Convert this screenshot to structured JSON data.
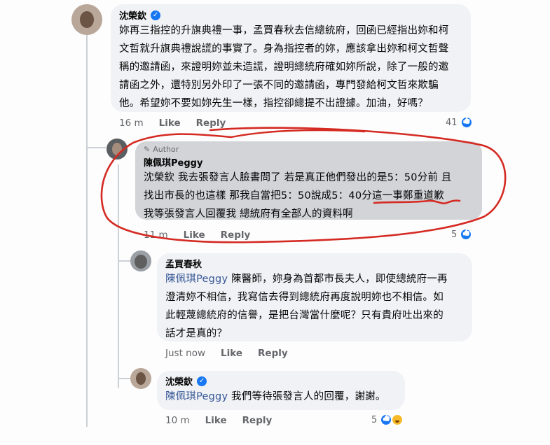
{
  "comments": [
    {
      "author": "沈榮欽",
      "verified": true,
      "lines": [
        "妳再三指控的升旗典禮一事，孟買春秋去信總統府，回函已經指出妳和柯",
        "文哲就升旗典禮說謊的事實了。身為指控者的妳，應該拿出妳和柯文哲聲",
        "稱的邀請函，來證明妳並未造謊，證明總統府確如妳所說，除了一般的邀",
        "請函之外，還特別另外印了一張不同的邀請函，專門發給柯文哲來欺騙",
        "他。希望妳不要如妳先生一樣，指控卻總提不出證據。加油，好嗎？"
      ],
      "time": "16 m",
      "like_label": "Like",
      "reply_label": "Reply",
      "reaction_count": "41"
    },
    {
      "author_badge": "Author",
      "author": "陳佩琪Peggy",
      "lines": [
        "沈榮欽 我去張發言人臉書問了 若是真正他們發出的是5：50分前 且",
        "找出市長的也這樣 那我自當把5：50說成5：40分這一事鄭重道歉",
        "我等張發言人回覆我 總統府有全部人的資料啊"
      ],
      "time": "11 m",
      "like_label": "Like",
      "reply_label": "Reply",
      "reaction_count": "5"
    },
    {
      "author": "孟買春秋",
      "mention": "陳佩琪Peggy",
      "first_line_rest": " 陳醫師，妳身為首都市長夫人，即使總統府一再",
      "lines": [
        "澄清妳不相信，我寫信去得到總統府再度說明妳也不相信。如",
        "此輕蔑總統府的信譽，是把台灣當什麼呢？只有貴府吐出來的",
        "話才是真的？"
      ],
      "time": "Just now",
      "like_label": "Like",
      "reply_label": "Reply"
    },
    {
      "author": "沈榮欽",
      "verified": true,
      "mention": "陳佩琪Peggy",
      "text_rest": " 我們等待張發言人的回覆，謝謝。",
      "time": "10 m",
      "like_label": "Like",
      "reply_label": "Reply",
      "reaction_count": "5"
    }
  ],
  "colors": {
    "facebook_blue": "#1877f2",
    "annotation_red": "#d42a22",
    "bubble_gray": "#f0f2f5",
    "author_bubble": "#d2d4d8"
  }
}
